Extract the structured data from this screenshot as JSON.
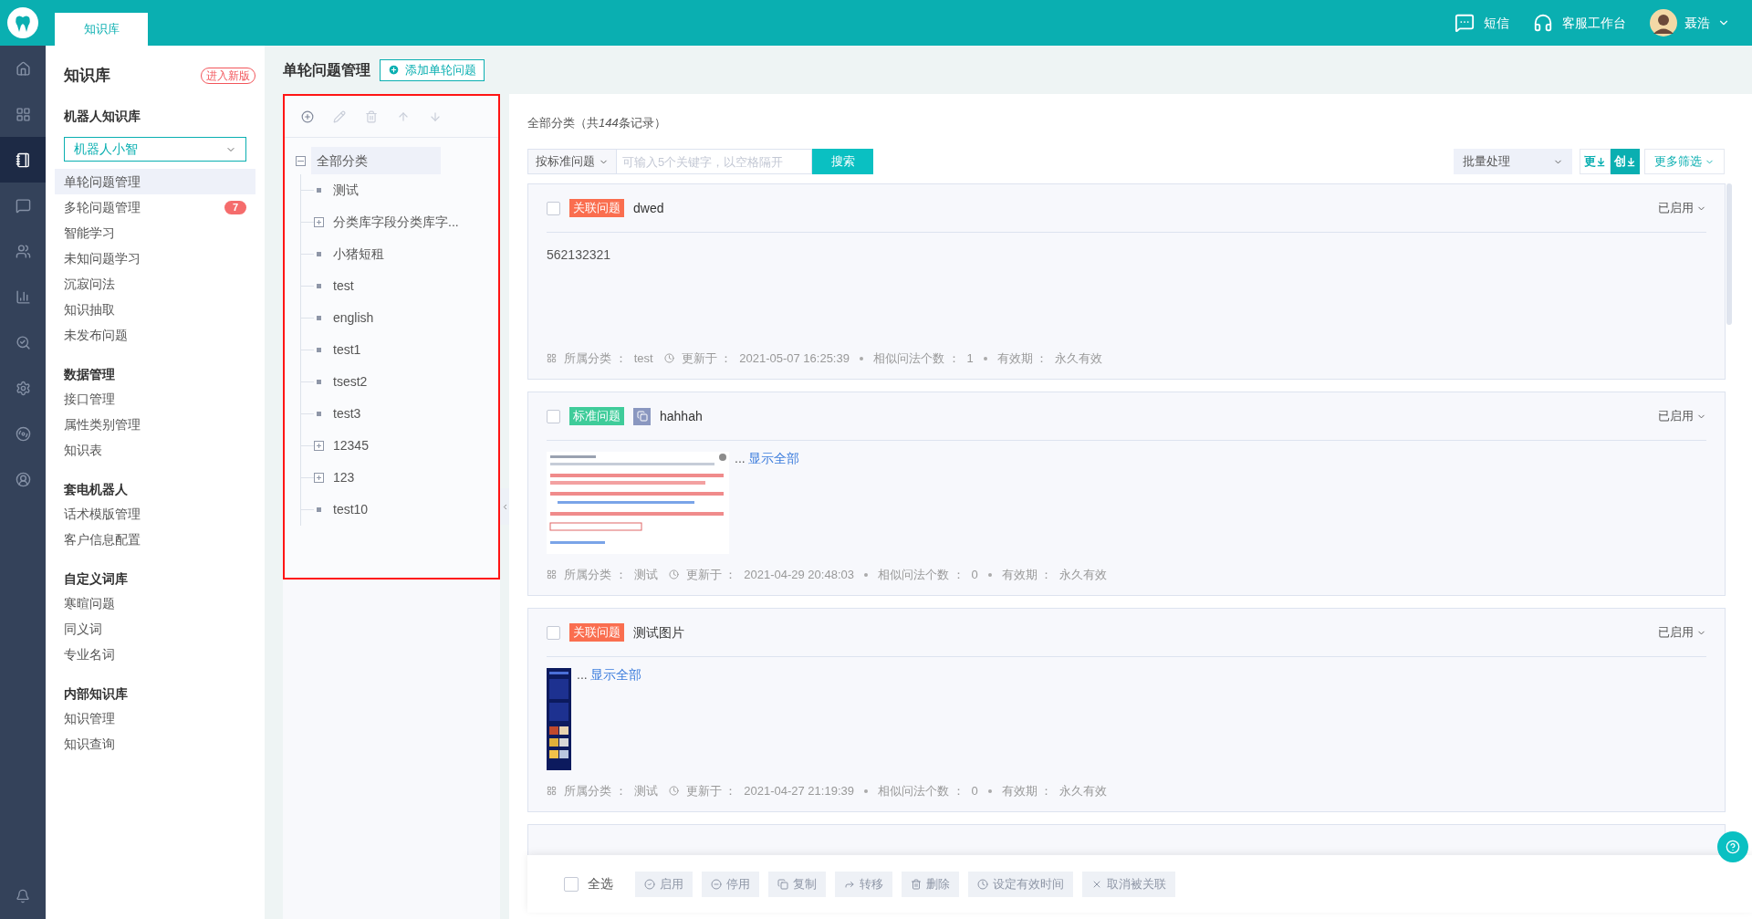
{
  "top_bar": {
    "tab": {
      "label": "知识库",
      "selected": true
    },
    "actions": [
      {
        "kind": "sms",
        "label": "短信"
      },
      {
        "kind": "workbench",
        "label": "客服工作台"
      },
      {
        "kind": "user",
        "label": "聂浩"
      }
    ]
  },
  "rail": [
    {
      "kind": "home",
      "selected": false
    },
    {
      "kind": "apps",
      "selected": false
    },
    {
      "kind": "book",
      "selected": true
    },
    {
      "kind": "chat",
      "selected": false
    },
    {
      "kind": "users",
      "selected": false
    },
    {
      "kind": "chart",
      "selected": false
    },
    {
      "kind": "inspect",
      "selected": false
    },
    {
      "kind": "settings",
      "selected": false
    },
    {
      "kind": "disc",
      "selected": false
    },
    {
      "kind": "profile",
      "selected": false
    }
  ],
  "sidebar": {
    "title": "知识库",
    "new_version": "进入新版",
    "sections": [
      {
        "title": "机器人知识库",
        "select": "机器人小智",
        "items": [
          {
            "label": "单轮问题管理",
            "selected": true
          },
          {
            "label": "多轮问题管理",
            "selected": false,
            "badge": "7"
          },
          {
            "label": "智能学习",
            "selected": false
          },
          {
            "label": "未知问题学习",
            "selected": false
          },
          {
            "label": "沉寂问法",
            "selected": false
          },
          {
            "label": "知识抽取",
            "selected": false
          },
          {
            "label": "未发布问题",
            "selected": false
          }
        ]
      },
      {
        "title": "数据管理",
        "items": [
          {
            "label": "接口管理",
            "selected": false
          },
          {
            "label": "属性类别管理",
            "selected": false
          },
          {
            "label": "知识表",
            "selected": false
          }
        ]
      },
      {
        "title": "套电机器人",
        "items": [
          {
            "label": "话术模版管理",
            "selected": false
          },
          {
            "label": "客户信息配置",
            "selected": false
          }
        ]
      },
      {
        "title": "自定义词库",
        "items": [
          {
            "label": "寒暄问题",
            "selected": false
          },
          {
            "label": "同义词",
            "selected": false
          },
          {
            "label": "专业名词",
            "selected": false
          }
        ]
      },
      {
        "title": "内部知识库",
        "items": [
          {
            "label": "知识管理",
            "selected": false
          },
          {
            "label": "知识查询",
            "selected": false
          }
        ]
      }
    ]
  },
  "page": {
    "title": "单轮问题管理",
    "add_button": "添加单轮问题"
  },
  "tree": {
    "tools": [
      {
        "kind": "add",
        "disabled": false
      },
      {
        "kind": "edit",
        "disabled": true
      },
      {
        "kind": "delete",
        "disabled": true
      },
      {
        "kind": "up",
        "disabled": true
      },
      {
        "kind": "down",
        "disabled": true
      }
    ],
    "root": {
      "label": "全部分类",
      "expanded": true,
      "selected": true,
      "children": [
        {
          "label": "测试",
          "kind": "leaf"
        },
        {
          "label": "分类库字段分类库字...",
          "kind": "folder"
        },
        {
          "label": "小猪短租",
          "kind": "leaf"
        },
        {
          "label": "test",
          "kind": "leaf"
        },
        {
          "label": "english",
          "kind": "leaf"
        },
        {
          "label": "test1",
          "kind": "leaf"
        },
        {
          "label": "tsest2",
          "kind": "leaf"
        },
        {
          "label": "test3",
          "kind": "leaf"
        },
        {
          "label": "12345",
          "kind": "folder"
        },
        {
          "label": "123",
          "kind": "folder"
        },
        {
          "label": "test10",
          "kind": "leaf"
        }
      ]
    }
  },
  "list": {
    "heading": {
      "before": "全部分类（共",
      "count": "144",
      "after": "条记录）"
    },
    "search": {
      "mode": "按标准问题",
      "placeholder": "可输入5个关键字，以空格隔开",
      "button": "搜索"
    },
    "batch": "批量处理",
    "sort_buttons": [
      {
        "label": "更",
        "selected": false
      },
      {
        "label": "创",
        "selected": true
      }
    ],
    "more_filter": "更多筛选",
    "cards": [
      {
        "checked": false,
        "tag": {
          "label": "关联问题",
          "kind": "related"
        },
        "linked": false,
        "title": "dwed",
        "status": "已启用",
        "content": {
          "kind": "text",
          "text": "562132321"
        },
        "meta": [
          {
            "kind": "category",
            "label": "所属分类 ：",
            "value": "test"
          },
          {
            "kind": "time",
            "label": "更新于 ：",
            "value": "2021-05-07 16:25:39"
          },
          {
            "kind": "count",
            "label": "相似问法个数 ：",
            "value": "1"
          },
          {
            "kind": "validity",
            "label": "有效期 ：",
            "value": "永久有效"
          }
        ]
      },
      {
        "checked": false,
        "tag": {
          "label": "标准问题",
          "kind": "standard"
        },
        "linked": true,
        "title": "hahhah",
        "status": "已启用",
        "content": {
          "kind": "picture",
          "ellipsis": "...",
          "link": "显示全部"
        },
        "meta": [
          {
            "kind": "category",
            "label": "所属分类 ：",
            "value": "测试"
          },
          {
            "kind": "time",
            "label": "更新于 ：",
            "value": "2021-04-29 20:48:03"
          },
          {
            "kind": "count",
            "label": "相似问法个数 ：",
            "value": "0"
          },
          {
            "kind": "validity",
            "label": "有效期 ：",
            "value": "永久有效"
          }
        ]
      },
      {
        "checked": false,
        "tag": {
          "label": "关联问题",
          "kind": "related"
        },
        "linked": false,
        "title": "测试图片",
        "status": "已启用",
        "content": {
          "kind": "picture",
          "ellipsis": "...",
          "link": "显示全部"
        },
        "meta": [
          {
            "kind": "category",
            "label": "所属分类 ：",
            "value": "测试"
          },
          {
            "kind": "time",
            "label": "更新于 ：",
            "value": "2021-04-27 21:19:39"
          },
          {
            "kind": "count",
            "label": "相似问法个数 ：",
            "value": "0"
          },
          {
            "kind": "validity",
            "label": "有效期 ：",
            "value": "永久有效"
          }
        ]
      }
    ]
  },
  "bottom_bar": {
    "select_all": {
      "label": "全选",
      "checked": false
    },
    "actions": [
      {
        "kind": "enable",
        "label": "启用",
        "disabled": true
      },
      {
        "kind": "disable",
        "label": "停用",
        "disabled": true
      },
      {
        "kind": "copy",
        "label": "复制",
        "disabled": true
      },
      {
        "kind": "move",
        "label": "转移",
        "disabled": true
      },
      {
        "kind": "delete",
        "label": "删除",
        "disabled": true
      },
      {
        "kind": "validity",
        "label": "设定有效时间",
        "disabled": true
      },
      {
        "kind": "unlink",
        "label": "取消被关联",
        "disabled": true
      }
    ]
  }
}
